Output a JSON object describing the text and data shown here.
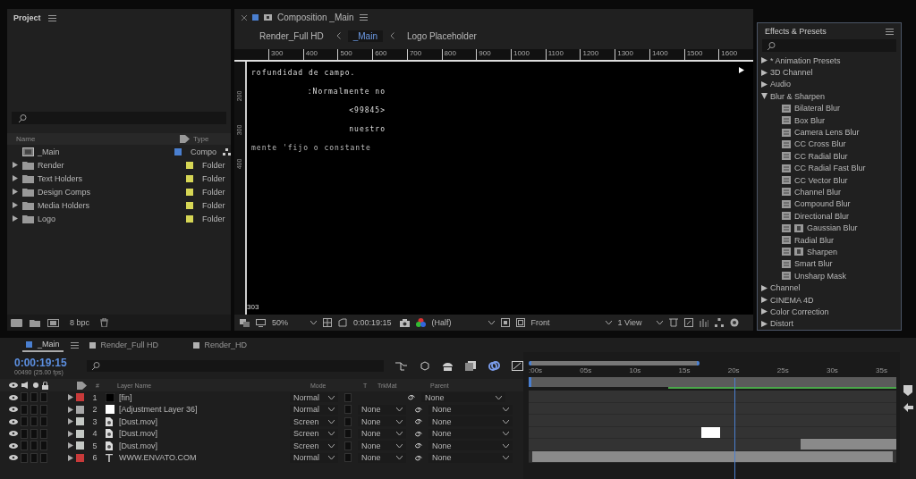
{
  "project": {
    "title": "Project",
    "columns": [
      "Name",
      "Type"
    ],
    "items": [
      {
        "kind": "comp",
        "name": "_Main",
        "type": "Compo",
        "color": "#4a7fd0"
      },
      {
        "kind": "folder",
        "name": "Render",
        "type": "Folder",
        "color": "#d6d655"
      },
      {
        "kind": "folder",
        "name": "Text Holders",
        "type": "Folder",
        "color": "#d6d655"
      },
      {
        "kind": "folder",
        "name": "Design Comps",
        "type": "Folder",
        "color": "#d6d655"
      },
      {
        "kind": "folder",
        "name": "Media Holders",
        "type": "Folder",
        "color": "#d6d655"
      },
      {
        "kind": "folder",
        "name": "Logo",
        "type": "Folder",
        "color": "#d6d655"
      }
    ],
    "bit_depth": "8 bpc"
  },
  "composition": {
    "title": "Composition _Main",
    "breadcrumbs": [
      {
        "label": "Render_Full HD",
        "selected": false
      },
      {
        "label": "_Main",
        "selected": true
      },
      {
        "label": "Logo Placeholder",
        "selected": false
      }
    ],
    "ruler_labels": [
      "300",
      "400",
      "500",
      "600",
      "700",
      "800",
      "900",
      "1000",
      "1100",
      "1200",
      "1300",
      "1400",
      "1500",
      "1600"
    ],
    "vertical_ruler_labels": [
      "200",
      "300",
      "400"
    ],
    "canvas_lines": [
      "rofundidad de campo.",
      ":Normalmente no",
      "<99845>",
      "nuestro",
      "mente 'fijo o constante"
    ],
    "coordinate": "303",
    "toolbar": {
      "zoom": "50%",
      "time": "0:00:19:15",
      "resolution": "(Half)",
      "view": "Front",
      "layout": "1 View"
    }
  },
  "effects": {
    "title": "Effects & Presets",
    "tree": [
      {
        "label": "* Animation Presets",
        "expanded": false
      },
      {
        "label": "3D Channel",
        "expanded": false
      },
      {
        "label": "Audio",
        "expanded": false
      },
      {
        "label": "Blur & Sharpen",
        "expanded": true,
        "children": [
          {
            "label": "Bilateral Blur",
            "gpu": false
          },
          {
            "label": "Box Blur",
            "gpu": false
          },
          {
            "label": "Camera Lens Blur",
            "gpu": false
          },
          {
            "label": "CC Cross Blur",
            "gpu": false
          },
          {
            "label": "CC Radial Blur",
            "gpu": false
          },
          {
            "label": "CC Radial Fast Blur",
            "gpu": false
          },
          {
            "label": "CC Vector Blur",
            "gpu": false
          },
          {
            "label": "Channel Blur",
            "gpu": false
          },
          {
            "label": "Compound Blur",
            "gpu": false
          },
          {
            "label": "Directional Blur",
            "gpu": false
          },
          {
            "label": "Gaussian Blur",
            "gpu": true
          },
          {
            "label": "Radial Blur",
            "gpu": false
          },
          {
            "label": "Sharpen",
            "gpu": true
          },
          {
            "label": "Smart Blur",
            "gpu": false
          },
          {
            "label": "Unsharp Mask",
            "gpu": false
          }
        ]
      },
      {
        "label": "Channel",
        "expanded": false
      },
      {
        "label": "CINEMA 4D",
        "expanded": false
      },
      {
        "label": "Color Correction",
        "expanded": false
      },
      {
        "label": "Distort",
        "expanded": false
      }
    ]
  },
  "timeline": {
    "tabs": [
      {
        "label": "_Main",
        "selected": true,
        "color": "#4a7fd0"
      },
      {
        "label": "Render_Full HD",
        "selected": false,
        "color": "#b0b0b0"
      },
      {
        "label": "Render_HD",
        "selected": false,
        "color": "#b0b0b0"
      }
    ],
    "current_time": "0:00:19:15",
    "frame_info": "00490 (25.00 fps)",
    "columns": [
      "#",
      "Layer Name",
      "Mode",
      "T",
      "TrkMat",
      "Parent"
    ],
    "ruler_labels": [
      ":00s",
      "05s",
      "10s",
      "15s",
      "20s",
      "25s",
      "30s",
      "35s"
    ],
    "layers": [
      {
        "index": "1",
        "kind": "solid-dark",
        "name": "[fin]",
        "mode": "Normal",
        "parent": "None",
        "color": "#c83a3a"
      },
      {
        "index": "2",
        "kind": "solid-light",
        "name": "[Adjustment Layer 36]",
        "mode": "Normal",
        "trkmat": "None",
        "parent": "None",
        "color": "#a8a8a8"
      },
      {
        "index": "3",
        "kind": "footage",
        "name": "[Dust.mov]",
        "mode": "Screen",
        "trkmat": "None",
        "parent": "None",
        "color": "#c4c8c4"
      },
      {
        "index": "4",
        "kind": "footage",
        "name": "[Dust.mov]",
        "mode": "Screen",
        "trkmat": "None",
        "parent": "None",
        "color": "#c4c8c4"
      },
      {
        "index": "5",
        "kind": "footage",
        "name": "[Dust.mov]",
        "mode": "Screen",
        "trkmat": "None",
        "parent": "None",
        "color": "#c4c8c4"
      },
      {
        "index": "6",
        "kind": "text",
        "name": "WWW.ENVATO.COM",
        "mode": "Normal",
        "trkmat": "None",
        "parent": "None",
        "color": "#c83a3a"
      }
    ]
  }
}
